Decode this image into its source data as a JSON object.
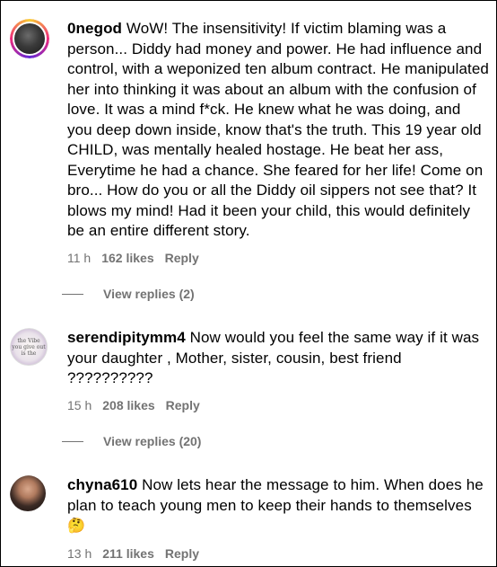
{
  "comments": [
    {
      "username": "0negod",
      "text": "WoW! The insensitivity! If victim blaming was a person... Diddy had money and power. He had influence and control, with a weponized ten album contract. He manipulated her into thinking it was about an album with the confusion of love. It was a mind f*ck. He knew what he was doing, and you deep down inside, know that's the truth. This 19 year old CHILD, was mentally healed hostage. He beat her ass, Everytime he had a chance. She feared for her life! Come on bro... How do you or all the Diddy oil sippers not see that? It blows my mind! Had it been your child, this would definitely be an entire different story.",
      "time": "11 h",
      "likes": "162 likes",
      "reply": "Reply",
      "view_replies": "View replies (2)"
    },
    {
      "username": "serendipitymm4",
      "text": "Now would you feel the same way if it was your daughter , Mother, sister, cousin, best friend ??????????",
      "time": "15 h",
      "likes": "208 likes",
      "reply": "Reply",
      "view_replies": "View replies (20)",
      "avatar_text": [
        "the Vibe",
        "you give out",
        "is the"
      ]
    },
    {
      "username": "chyna610",
      "text": "Now lets hear the message to him. When does he plan to teach young men to keep their hands to themselves",
      "emoji": "🤔",
      "time": "13 h",
      "likes": "211 likes",
      "reply": "Reply"
    }
  ]
}
